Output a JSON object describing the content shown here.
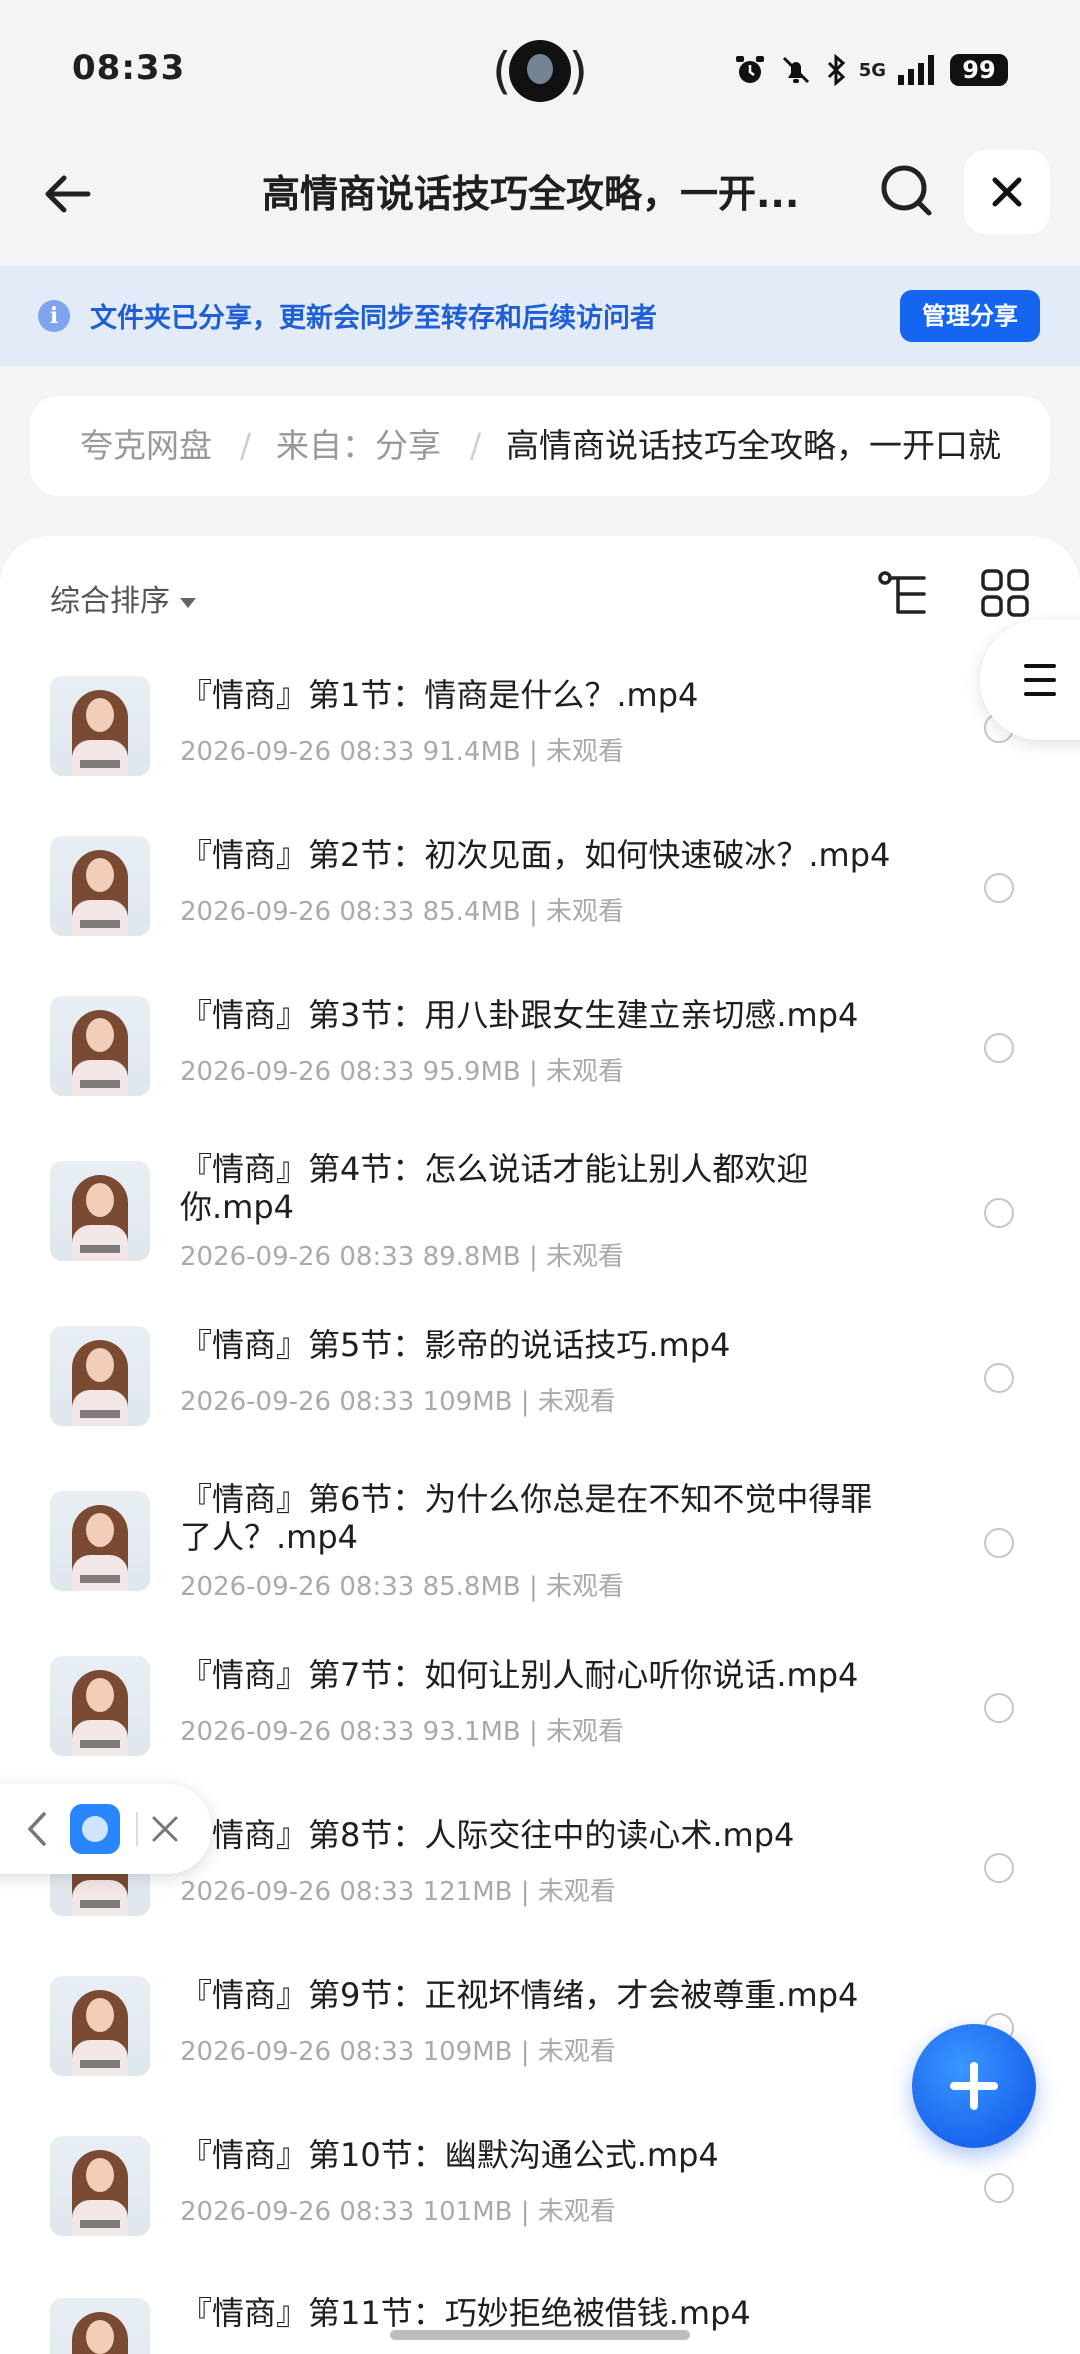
{
  "status_bar": {
    "time": "08:33",
    "network": "5G",
    "battery": "99"
  },
  "header": {
    "title": "高情商说话技巧全攻略，一开..."
  },
  "banner": {
    "text": "文件夹已分享，更新会同步至转存和后续访问者",
    "button": "管理分享"
  },
  "breadcrumb": {
    "items": [
      "夸克网盘",
      "来自：分享",
      "高情商说话技巧全攻略，一开口就"
    ],
    "separator": "/"
  },
  "toolbar": {
    "sort_label": "综合排序"
  },
  "files": [
    {
      "name": "『情商』第1节：情商是什么？.mp4",
      "date": "2026-09-26 08:33",
      "size": "91.4MB",
      "status": "未观看"
    },
    {
      "name": "『情商』第2节：初次见面，如何快速破冰？.mp4",
      "date": "2026-09-26 08:33",
      "size": "85.4MB",
      "status": "未观看"
    },
    {
      "name": "『情商』第3节：用八卦跟女生建立亲切感.mp4",
      "date": "2026-09-26 08:33",
      "size": "95.9MB",
      "status": "未观看"
    },
    {
      "name": "『情商』第4节：怎么说话才能让别人都欢迎你.mp4",
      "date": "2026-09-26 08:33",
      "size": "89.8MB",
      "status": "未观看"
    },
    {
      "name": "『情商』第5节：影帝的说话技巧.mp4",
      "date": "2026-09-26 08:33",
      "size": "109MB",
      "status": "未观看"
    },
    {
      "name": "『情商』第6节：为什么你总是在不知不觉中得罪了人？.mp4",
      "date": "2026-09-26 08:33",
      "size": "85.8MB",
      "status": "未观看"
    },
    {
      "name": "『情商』第7节：如何让别人耐心听你说话.mp4",
      "date": "2026-09-26 08:33",
      "size": "93.1MB",
      "status": "未观看"
    },
    {
      "name": "『情商』第8节：人际交往中的读心术.mp4",
      "date": "2026-09-26 08:33",
      "size": "121MB",
      "status": "未观看"
    },
    {
      "name": "『情商』第9节：正视坏情绪，才会被尊重.mp4",
      "date": "2026-09-26 08:33",
      "size": "109MB",
      "status": "未观看"
    },
    {
      "name": "『情商』第10节：幽默沟通公式.mp4",
      "date": "2026-09-26 08:33",
      "size": "101MB",
      "status": "未观看"
    },
    {
      "name": "『情商』第11节：巧妙拒绝被借钱.mp4",
      "date": "",
      "size": "",
      "status": ""
    }
  ],
  "meta_separator": "|"
}
